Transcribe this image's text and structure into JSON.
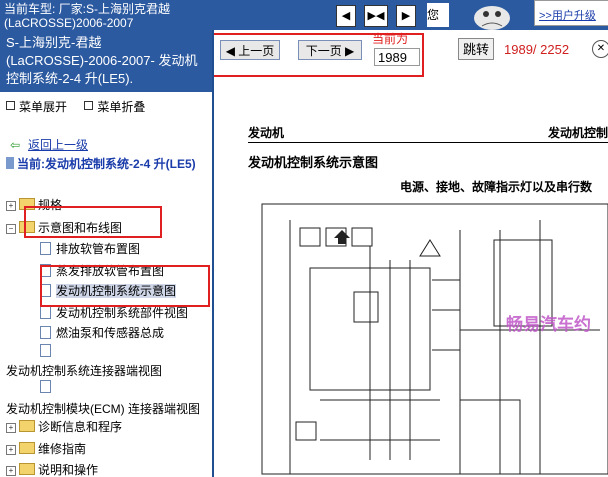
{
  "topbar": {
    "title_line1": "当前车型: 厂家:S-上海别克君越",
    "title_line2": "(LaCROSSE)2006-2007",
    "nav_buttons": [
      "◀",
      "▶◀",
      "▶"
    ],
    "speaker_text": "您的",
    "upgrade_link": ">>用户升级"
  },
  "sidebar": {
    "car_title": "S-上海别克-君越(LaCROSSE)-2006-2007- 发动机控制系统-2-4 升(LE5).",
    "menu_expand": "菜单展开",
    "menu_collapse": "菜单折叠",
    "back_link": "返回上一级",
    "current_label": "当前:发动机控制系统-2-4 升(LE5)",
    "tree": {
      "guige": "规格",
      "diagrams_folder": "示意图和布线图",
      "pai_fang": "排放软管布置图",
      "zhengfa": "蒸发排放软管布置图",
      "engine_control": "发动机控制系统示意图",
      "engine_parts": "发动机控制系统部件视图",
      "fuel_pump": "燃油泵和传感器总成",
      "connector_view": "发动机控制系统连接器端视图",
      "ecm_connector": "发动机控制模块(ECM) 连接器端视图",
      "diag": "诊断信息和程序",
      "repair": "维修指南",
      "desc": "说明和操作"
    }
  },
  "main": {
    "prev_page": "上一页",
    "next_page": "下一页",
    "current_label": "当前为",
    "page_value": "1989",
    "jump": "跳转",
    "page_count": "1989/ 2252",
    "doc_header_left": "发动机",
    "doc_header_right": "发动机控制",
    "doc_title": "发动机控制系统示意图",
    "doc_subtitle": "电源、接地、故障指示灯以及串行数",
    "watermark": "畅易汽车约"
  },
  "colors": {
    "titlebar": "#2c5aa0",
    "highlight_box": "#e02020",
    "link": "#1a3caa"
  }
}
